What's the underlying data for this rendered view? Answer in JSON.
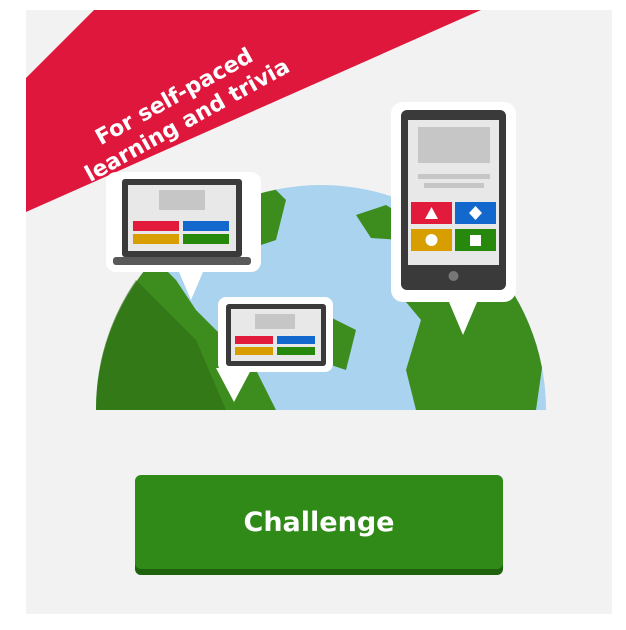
{
  "ribbon": {
    "line1": "For self-paced",
    "line2": "learning and trivia",
    "color": "#e0173d"
  },
  "cta": {
    "label": "Challenge",
    "color": "#2f8a17"
  },
  "colors": {
    "ocean": "#a9d3ee",
    "land": "#3d8c1e",
    "device_frame": "#3a3a3a",
    "answer_red": "#e21b3c",
    "answer_blue": "#1368ce",
    "answer_yellow": "#d89e00",
    "answer_green": "#26890c"
  },
  "icons": [
    "triangle-icon",
    "diamond-icon",
    "circle-icon",
    "square-icon"
  ]
}
